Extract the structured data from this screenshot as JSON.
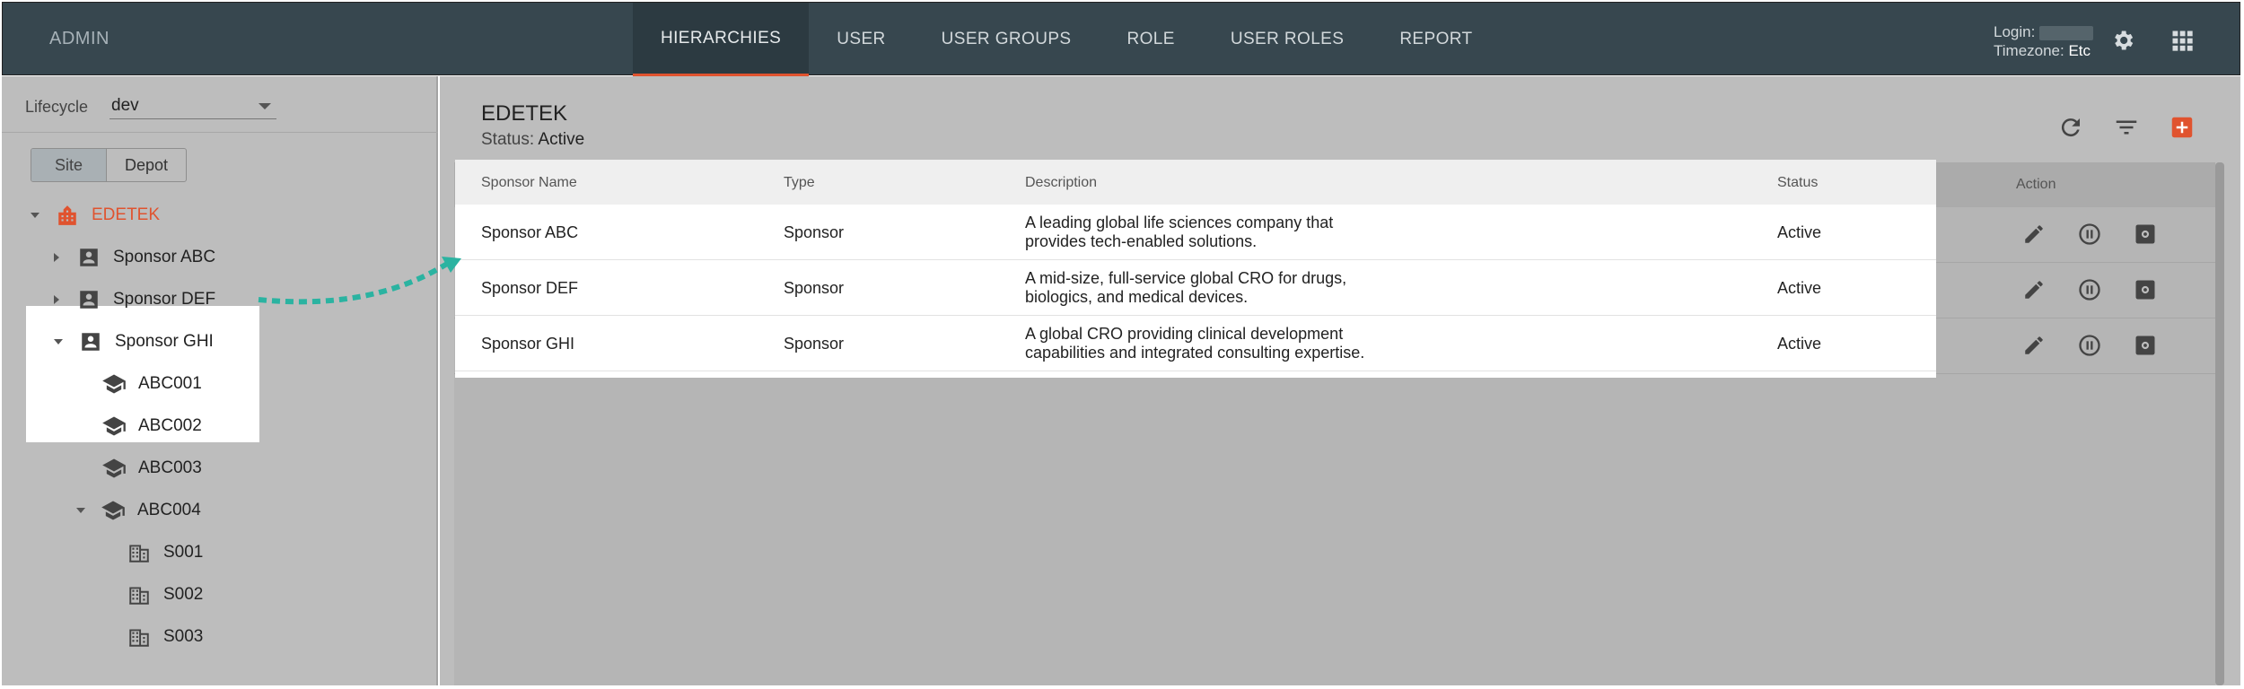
{
  "topbar": {
    "brand": "ADMIN",
    "tabs": [
      {
        "label": "HIERARCHIES",
        "active": true
      },
      {
        "label": "USER"
      },
      {
        "label": "USER GROUPS"
      },
      {
        "label": "ROLE"
      },
      {
        "label": "USER ROLES"
      },
      {
        "label": "REPORT"
      }
    ],
    "login_label": "Login:",
    "timezone_label": "Timezone:",
    "timezone_value": "Etc",
    "icons": [
      "gear-icon",
      "apps-grid-icon"
    ]
  },
  "sidebar": {
    "lifecycle_label": "Lifecycle",
    "lifecycle_value": "dev",
    "toggle": [
      {
        "label": "Site",
        "active": true
      },
      {
        "label": "Depot"
      }
    ],
    "tree": [
      {
        "label": "EDETEK",
        "icon": "organization-icon",
        "expanded": true
      },
      {
        "label": "Sponsor ABC",
        "icon": "account-box-icon",
        "expanded": false
      },
      {
        "label": "Sponsor DEF",
        "icon": "account-box-icon",
        "expanded": false
      },
      {
        "label": "Sponsor GHI",
        "icon": "account-box-icon",
        "expanded": true
      },
      {
        "label": "ABC001",
        "icon": "school-icon"
      },
      {
        "label": "ABC002",
        "icon": "school-icon"
      },
      {
        "label": "ABC003",
        "icon": "school-icon"
      },
      {
        "label": "ABC004",
        "icon": "school-icon",
        "expanded": true
      },
      {
        "label": "S001",
        "icon": "building-icon"
      },
      {
        "label": "S002",
        "icon": "building-icon"
      },
      {
        "label": "S003",
        "icon": "building-icon"
      }
    ]
  },
  "main": {
    "title": "EDETEK",
    "status_label": "Status:",
    "status_value": "Active",
    "toolbar_icons": [
      "refresh-icon",
      "filter-icon",
      "add-icon"
    ],
    "columns": [
      "Sponsor Name",
      "Type",
      "Description",
      "Status",
      "Action"
    ],
    "rows": [
      {
        "name": "Sponsor ABC",
        "type": "Sponsor",
        "desc1": "A leading global life sciences company that",
        "desc2": "provides tech-enabled solutions.",
        "status": "Active"
      },
      {
        "name": "Sponsor DEF",
        "type": "Sponsor",
        "desc1": "A mid-size, full-service global CRO for drugs,",
        "desc2": "biologics, and medical devices.",
        "status": "Active"
      },
      {
        "name": "Sponsor GHI",
        "type": "Sponsor",
        "desc1": "A global CRO providing clinical development",
        "desc2": "capabilities and integrated consulting expertise.",
        "status": "Active"
      }
    ],
    "row_action_icons": [
      "edit-icon",
      "pause-icon",
      "settings-icon"
    ]
  },
  "colors": {
    "topbar": "#37474f",
    "accent": "#e0532f",
    "overlay_grey": "#bdbdbd",
    "arrow": "#2bb3a1"
  }
}
